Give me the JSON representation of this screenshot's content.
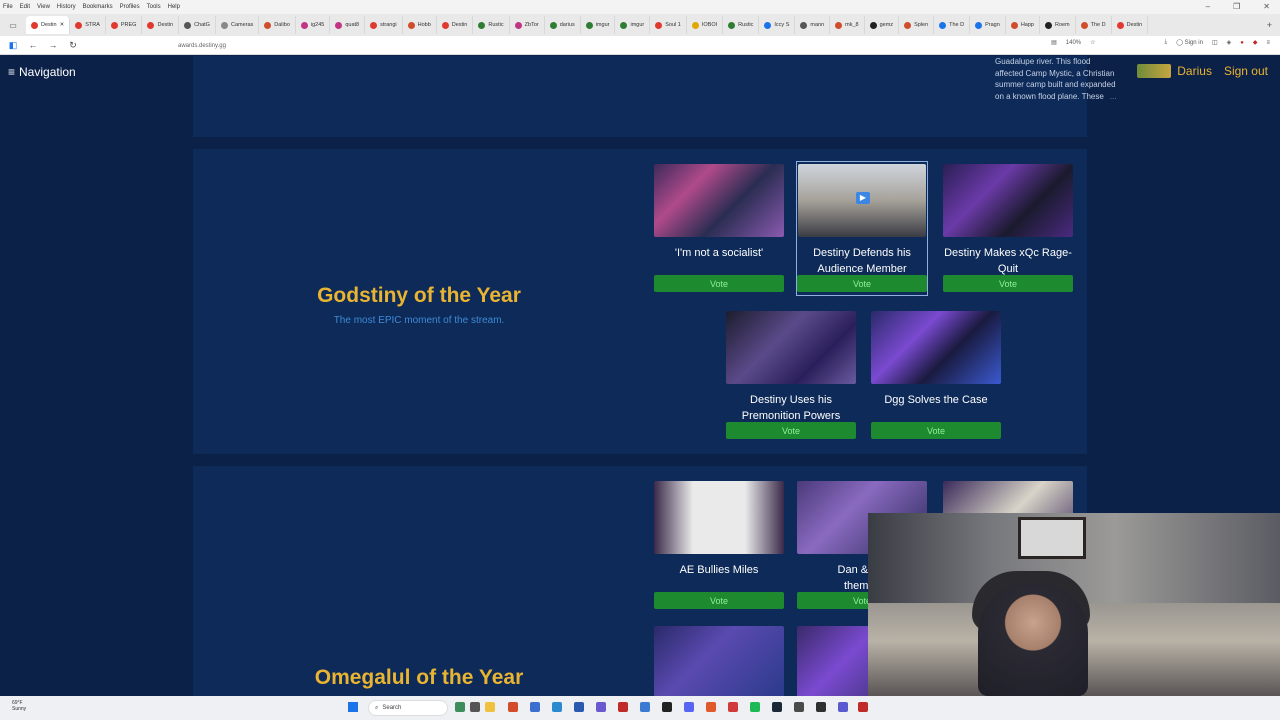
{
  "browser": {
    "menu": [
      "File",
      "Edit",
      "View",
      "History",
      "Bookmarks",
      "Profiles",
      "Tools",
      "Help"
    ],
    "tabs": [
      {
        "label": "Destin",
        "color": "#e0392f"
      },
      {
        "label": "STRA",
        "color": "#e0392f"
      },
      {
        "label": "PREG",
        "color": "#e0392f"
      },
      {
        "label": "Destin",
        "color": "#e0392f"
      },
      {
        "label": "ChatG",
        "color": "#555555"
      },
      {
        "label": "Cameras",
        "color": "#888888"
      },
      {
        "label": "Dalibo",
        "color": "#d24b2a"
      },
      {
        "label": "ig245",
        "color": "#c13584"
      },
      {
        "label": "quat8",
        "color": "#c13584"
      },
      {
        "label": "strangi",
        "color": "#e0392f"
      },
      {
        "label": "Hobb",
        "color": "#d24b2a"
      },
      {
        "label": "Destin",
        "color": "#e0392f"
      },
      {
        "label": "Rustic",
        "color": "#2e7d32"
      },
      {
        "label": "ZbTor",
        "color": "#c13584"
      },
      {
        "label": "darius",
        "color": "#2e7d32"
      },
      {
        "label": "imgur",
        "color": "#2e7d32"
      },
      {
        "label": "imgur",
        "color": "#2e7d32"
      },
      {
        "label": "Soul 1",
        "color": "#e0392f"
      },
      {
        "label": "IOBOI",
        "color": "#e0a800"
      },
      {
        "label": "Rustic",
        "color": "#2e7d32"
      },
      {
        "label": "Iccy S",
        "color": "#1a73e8"
      },
      {
        "label": "mann",
        "color": "#555555"
      },
      {
        "label": "mk_8",
        "color": "#d24b2a"
      },
      {
        "label": "gemz",
        "color": "#222222"
      },
      {
        "label": "Splen",
        "color": "#d24b2a"
      },
      {
        "label": "The D",
        "color": "#1a73e8"
      },
      {
        "label": "Pragn",
        "color": "#1a73e8"
      },
      {
        "label": "Happ",
        "color": "#d24b2a"
      },
      {
        "label": "Roem",
        "color": "#222222"
      },
      {
        "label": "The D",
        "color": "#d24b2a"
      },
      {
        "label": "Destin",
        "color": "#e0392f"
      }
    ],
    "url": "awards.destiny.gg",
    "zoom": "140%",
    "sign_in": "Sign in"
  },
  "header": {
    "nav_label": "Navigation",
    "username": "Darius",
    "signout": "Sign out"
  },
  "previous_panel": {
    "description": "Guadalupe river. This flood affected Camp Mystic, a Christian summer camp built and expanded on a known flood plane. These",
    "more": "..."
  },
  "categories": [
    {
      "title": "Godstiny of the Year",
      "subtitle": "The most EPIC moment of the stream.",
      "nominees": [
        {
          "title": "'I'm not a socialist'",
          "vote": "Vote",
          "selected": false
        },
        {
          "title": "Destiny Defends his Audience Member",
          "vote": "Vote",
          "selected": true
        },
        {
          "title": "Destiny Makes xQc Rage-Quit",
          "vote": "Vote",
          "selected": false
        },
        {
          "title": "Destiny Uses his Premonition Powers",
          "vote": "Vote",
          "selected": false
        },
        {
          "title": "Dgg Solves the Case",
          "vote": "Vote",
          "selected": false
        }
      ]
    },
    {
      "title": "Omegalul of the Year",
      "subtitle": "",
      "nominees": [
        {
          "title": "AE Bullies Miles",
          "vote": "Vote",
          "selected": false
        },
        {
          "title": "Dan & Mo",
          "title2": "themse",
          "vote": "Vote",
          "selected": false
        }
      ]
    }
  ],
  "taskbar": {
    "weather_temp": "69°F",
    "weather_desc": "Sunny",
    "search": "Search"
  }
}
